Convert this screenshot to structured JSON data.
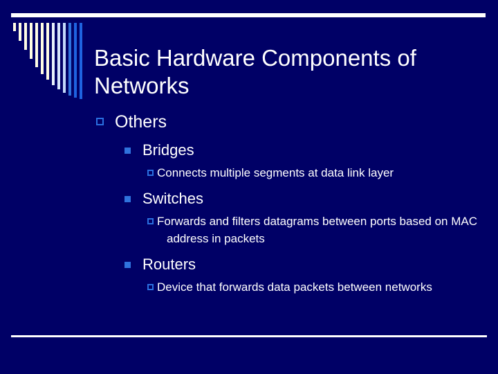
{
  "slide": {
    "background_color": "#000066",
    "text_color": "#ffffff",
    "accent_color": "#2a6fe0",
    "title": "Basic Hardware Components of Networks",
    "rules": {
      "top": "top-horizontal-rule",
      "bottom": "bottom-horizontal-rule"
    },
    "decoration": {
      "name": "descending-bar-graphic",
      "bar_count": 13,
      "colors": [
        "#fffde4",
        "#fffde4",
        "#fffde4",
        "#fffde4",
        "#fffde4",
        "#fffde4",
        "#fffde4",
        "#e8f0fb",
        "#d6e4fb",
        "#c3d9fa",
        "#2f73dd",
        "#1f63e0",
        "#1f63e0"
      ],
      "heights": [
        12,
        26,
        39,
        52,
        64,
        74,
        82,
        90,
        96,
        101,
        105,
        108,
        110
      ]
    },
    "content": {
      "level1": {
        "label": "Others",
        "bullet": "hollow-square-bullet"
      },
      "items": [
        {
          "label": "Bridges",
          "bullet": "filled-square-bullet",
          "details": [
            {
              "text": "Connects multiple segments at data link layer",
              "bullet": "hollow-square-bullet"
            }
          ]
        },
        {
          "label": "Switches",
          "bullet": "filled-square-bullet",
          "details": [
            {
              "text": "Forwards and filters datagrams between ports based on MAC address in packets",
              "bullet": "hollow-square-bullet"
            }
          ]
        },
        {
          "label": "Routers",
          "bullet": "filled-square-bullet",
          "details": [
            {
              "text": "Device that forwards data packets between networks",
              "bullet": "hollow-square-bullet"
            }
          ]
        }
      ]
    }
  }
}
